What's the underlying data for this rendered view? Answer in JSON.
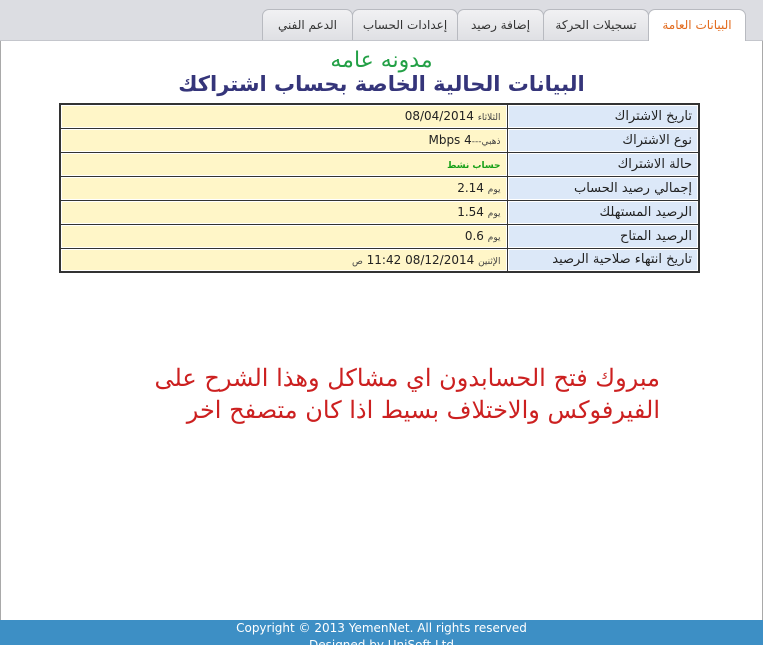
{
  "tabs": [
    {
      "label": "البيانات العامة",
      "active": true
    },
    {
      "label": "تسجيلات الحركة",
      "active": false
    },
    {
      "label": "إضافة رصيد",
      "active": false
    },
    {
      "label": "إعدادات الحساب",
      "active": false
    },
    {
      "label": "الدعم الفني",
      "active": false
    }
  ],
  "blog_name": "مدونه عامه",
  "page_title": "البيانات الحالية الخاصة بحساب اشتراكك",
  "rows": [
    {
      "label": "تاريخ الاشتراك",
      "prefix": "الثلاثاء",
      "value": "08/04/2014"
    },
    {
      "label": "نوع الاشتراك",
      "prefix": "ذهبي---",
      "value": "4 Mbps"
    },
    {
      "label": "حالة الاشتراك",
      "prefix": "",
      "value": "حساب نشط"
    },
    {
      "label": "إجمالي رصيد الحساب",
      "prefix": "يوم",
      "value": "2.14"
    },
    {
      "label": "الرصيد المستهلك",
      "prefix": "يوم",
      "value": "1.54"
    },
    {
      "label": "الرصيد المتاح",
      "prefix": "يوم",
      "value": "0.6"
    },
    {
      "label": "تاريخ انتهاء صلاحية الرصيد",
      "prefix": "الإثنين",
      "value": "08/12/2014 11:42",
      "suffix": "ص"
    }
  ],
  "note": "مبروك فتح الحسابدون اي مشاكل وهذا الشرح على الفيرفوكس والاختلاف بسيط اذا كان متصفح اخر",
  "footer": {
    "line1": "Copyright © 2013 YemenNet.  All rights reserved",
    "line2": "Designed by UniSoft Ltd"
  },
  "colors": {
    "active_tab": "#e2691a",
    "blog_name": "#23a046",
    "title": "#35357a",
    "note": "#cc2020",
    "footer_bg": "#3d8fc5",
    "label_bg": "#dce8f8",
    "value_bg": "#fff6c8"
  }
}
